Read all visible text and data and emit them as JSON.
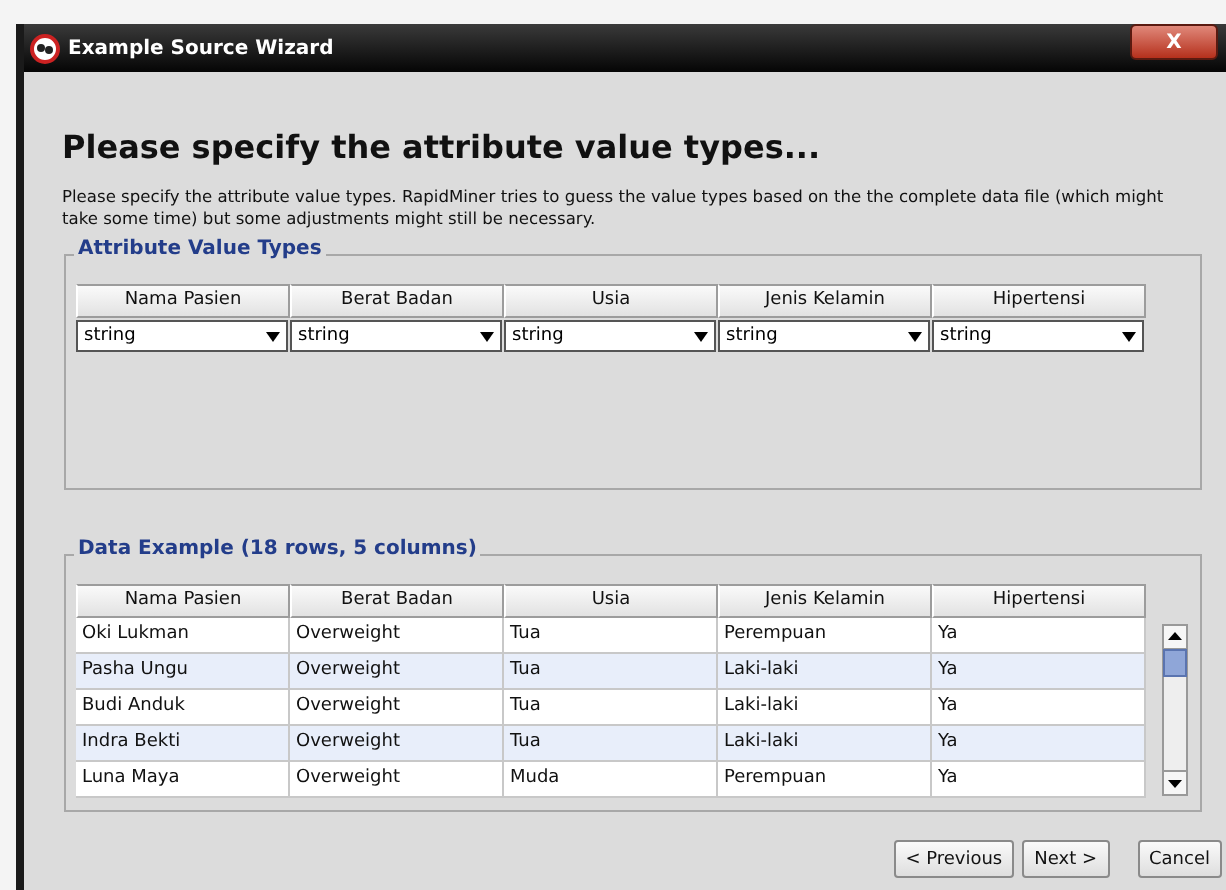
{
  "window": {
    "title": "Example Source Wizard",
    "close_glyph": "X"
  },
  "heading": "Please specify the attribute value types...",
  "description": "Please specify the attribute value types. RapidMiner tries to guess the value types based on the the complete data file (which might take some time) but some adjustments might still be necessary.",
  "attribute_value_types": {
    "title": "Attribute Value Types",
    "columns": [
      {
        "name": "Nama Pasien",
        "type": "string"
      },
      {
        "name": "Berat Badan",
        "type": "string"
      },
      {
        "name": "Usia",
        "type": "string"
      },
      {
        "name": "Jenis Kelamin",
        "type": "string"
      },
      {
        "name": "Hipertensi",
        "type": "string"
      }
    ]
  },
  "data_example": {
    "title": "Data Example (18 rows, 5 columns)",
    "columns": [
      "Nama Pasien",
      "Berat Badan",
      "Usia",
      "Jenis Kelamin",
      "Hipertensi"
    ],
    "rows": [
      [
        "Oki Lukman",
        "Overweight",
        "Tua",
        "Perempuan",
        "Ya"
      ],
      [
        "Pasha Ungu",
        "Overweight",
        "Tua",
        "Laki-laki",
        "Ya"
      ],
      [
        "Budi Anduk",
        "Overweight",
        "Tua",
        "Laki-laki",
        "Ya"
      ],
      [
        "Indra Bekti",
        "Overweight",
        "Tua",
        "Laki-laki",
        "Ya"
      ],
      [
        "Luna Maya",
        "Overweight",
        "Muda",
        "Perempuan",
        "Ya"
      ]
    ]
  },
  "buttons": [
    {
      "label": "< Previous",
      "kind": "nav"
    },
    {
      "label": "Next >",
      "kind": "nav"
    },
    {
      "label": "Cancel",
      "kind": "cancel"
    }
  ]
}
